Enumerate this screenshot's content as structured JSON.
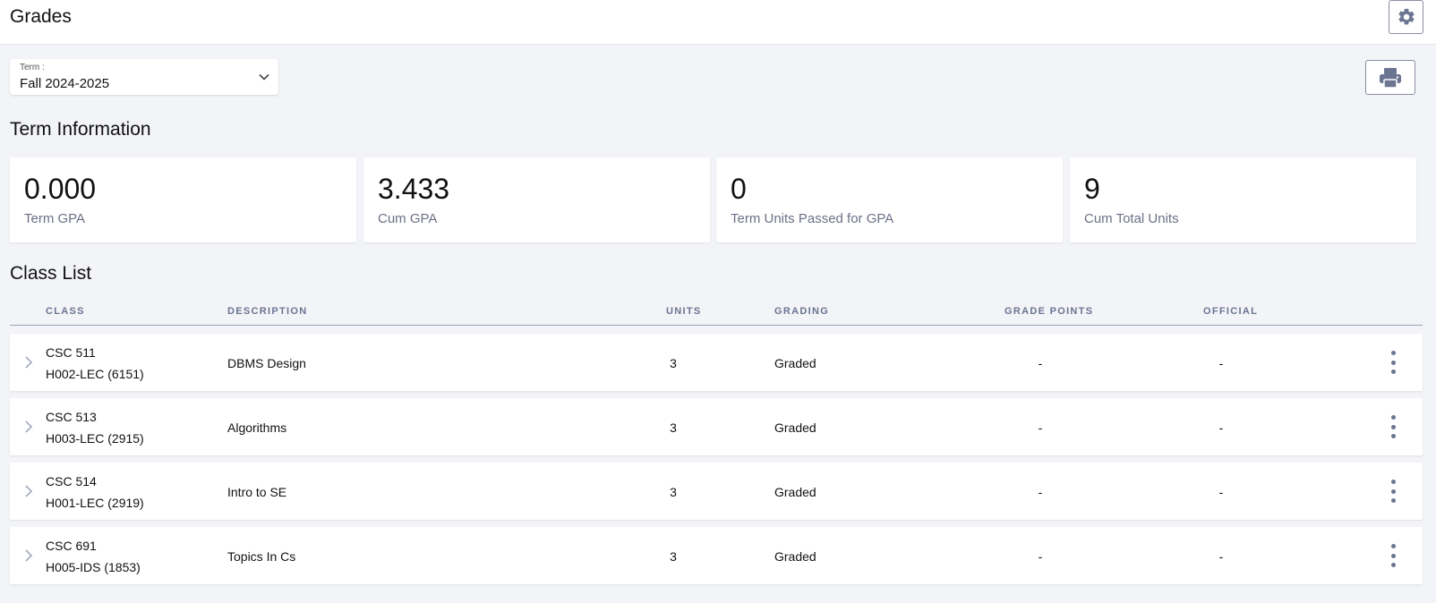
{
  "header": {
    "title": "Grades"
  },
  "term_select": {
    "label": "Term :",
    "value": "Fall 2024-2025"
  },
  "term_info": {
    "title": "Term Information",
    "cards": [
      {
        "value": "0.000",
        "label": "Term GPA"
      },
      {
        "value": "3.433",
        "label": "Cum GPA"
      },
      {
        "value": "0",
        "label": "Term Units Passed for GPA"
      },
      {
        "value": "9",
        "label": "Cum Total Units"
      }
    ]
  },
  "class_list": {
    "title": "Class List",
    "columns": [
      "CLASS",
      "DESCRIPTION",
      "UNITS",
      "GRADING",
      "GRADE POINTS",
      "OFFICIAL"
    ],
    "rows": [
      {
        "class": "CSC 511",
        "section": "H002-LEC (6151)",
        "description": "DBMS Design",
        "units": "3",
        "grading": "Graded",
        "grade_points": "-",
        "official": "-"
      },
      {
        "class": "CSC 513",
        "section": "H003-LEC (2915)",
        "description": "Algorithms",
        "units": "3",
        "grading": "Graded",
        "grade_points": "-",
        "official": "-"
      },
      {
        "class": "CSC 514",
        "section": "H001-LEC (2919)",
        "description": "Intro to SE",
        "units": "3",
        "grading": "Graded",
        "grade_points": "-",
        "official": "-"
      },
      {
        "class": "CSC 691",
        "section": "H005-IDS (1853)",
        "description": "Topics In Cs",
        "units": "3",
        "grading": "Graded",
        "grade_points": "-",
        "official": "-"
      }
    ]
  },
  "icons": {
    "settings": "gear-icon",
    "print": "printer-icon",
    "dropdown": "chevron-down-icon",
    "expand": "chevron-right-icon",
    "more": "kebab-menu-icon"
  },
  "colors": {
    "background": "#f3f4f8",
    "accent": "#6b7491",
    "muted_text": "#6b7086"
  }
}
